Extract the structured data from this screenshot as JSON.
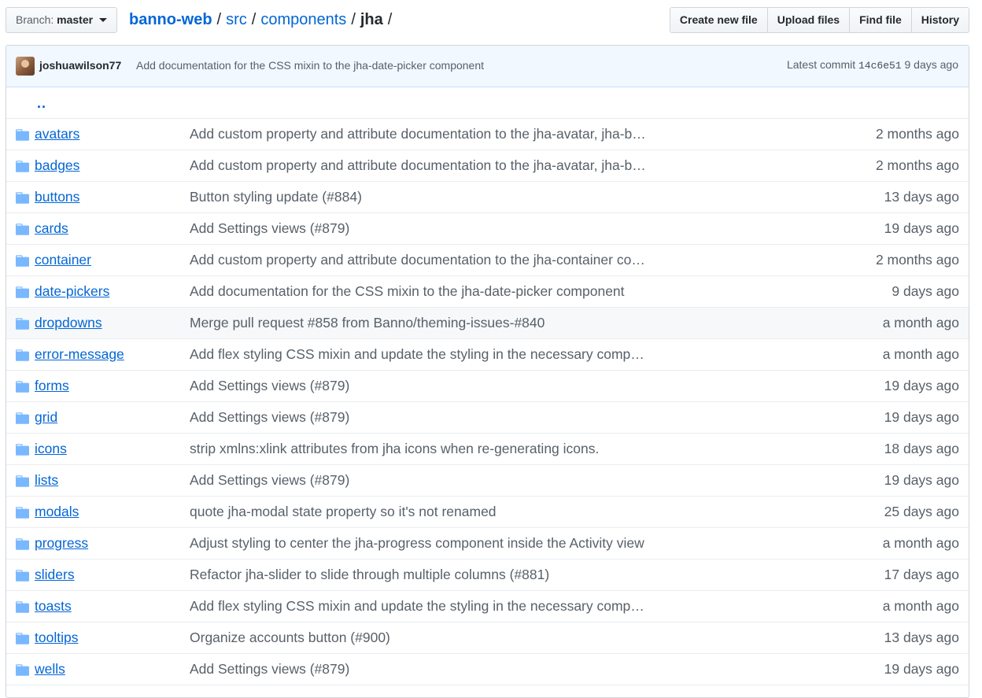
{
  "branch": {
    "label": "Branch:",
    "value": "master"
  },
  "breadcrumb": {
    "repo": "banno-web",
    "parts": [
      "src",
      "components"
    ],
    "current": "jha",
    "sep": "/"
  },
  "actions": [
    "Create new file",
    "Upload files",
    "Find file",
    "History"
  ],
  "latest_commit": {
    "author": "joshuawilson77",
    "message": "Add documentation for the CSS mixin to the jha-date-picker component",
    "prefix": "Latest commit",
    "sha": "14c6e51",
    "age": "9 days ago"
  },
  "up_link": "..",
  "folder_icon": "folder-icon",
  "colors": {
    "link": "#0366d6",
    "folder": "#79b8ff",
    "muted": "#586069",
    "tease_bg": "#f1f8ff"
  },
  "rows": [
    {
      "name": "avatars",
      "message": "Add custom property and attribute documentation to the jha-avatar, jha-badge component",
      "age": "2 months ago"
    },
    {
      "name": "badges",
      "message": "Add custom property and attribute documentation to the jha-avatar, jha-badge component",
      "age": "2 months ago"
    },
    {
      "name": "buttons",
      "message": "Button styling update (#884)",
      "age": "13 days ago"
    },
    {
      "name": "cards",
      "message": "Add Settings views (#879)",
      "age": "19 days ago"
    },
    {
      "name": "container",
      "message": "Add custom property and attribute documentation to the jha-container component",
      "age": "2 months ago"
    },
    {
      "name": "date-pickers",
      "message": "Add documentation for the CSS mixin to the jha-date-picker component",
      "age": "9 days ago"
    },
    {
      "name": "dropdowns",
      "message": "Merge pull request #858 from Banno/theming-issues-#840",
      "age": "a month ago",
      "hover": true
    },
    {
      "name": "error-message",
      "message": "Add flex styling CSS mixin and update the styling in the necessary components",
      "age": "a month ago"
    },
    {
      "name": "forms",
      "message": "Add Settings views (#879)",
      "age": "19 days ago"
    },
    {
      "name": "grid",
      "message": "Add Settings views (#879)",
      "age": "19 days ago"
    },
    {
      "name": "icons",
      "message": "strip xmlns:xlink attributes from jha icons when re-generating icons.",
      "age": "18 days ago"
    },
    {
      "name": "lists",
      "message": "Add Settings views (#879)",
      "age": "19 days ago"
    },
    {
      "name": "modals",
      "message": "quote jha-modal state property so it's not renamed",
      "age": "25 days ago"
    },
    {
      "name": "progress",
      "message": "Adjust styling to center the jha-progress component inside the Activity view",
      "age": "a month ago"
    },
    {
      "name": "sliders",
      "message": "Refactor jha-slider to slide through multiple columns (#881)",
      "age": "17 days ago"
    },
    {
      "name": "toasts",
      "message": "Add flex styling CSS mixin and update the styling in the necessary components",
      "age": "a month ago"
    },
    {
      "name": "tooltips",
      "message": "Organize accounts button (#900)",
      "age": "13 days ago"
    },
    {
      "name": "wells",
      "message": "Add Settings views (#879)",
      "age": "19 days ago"
    }
  ]
}
